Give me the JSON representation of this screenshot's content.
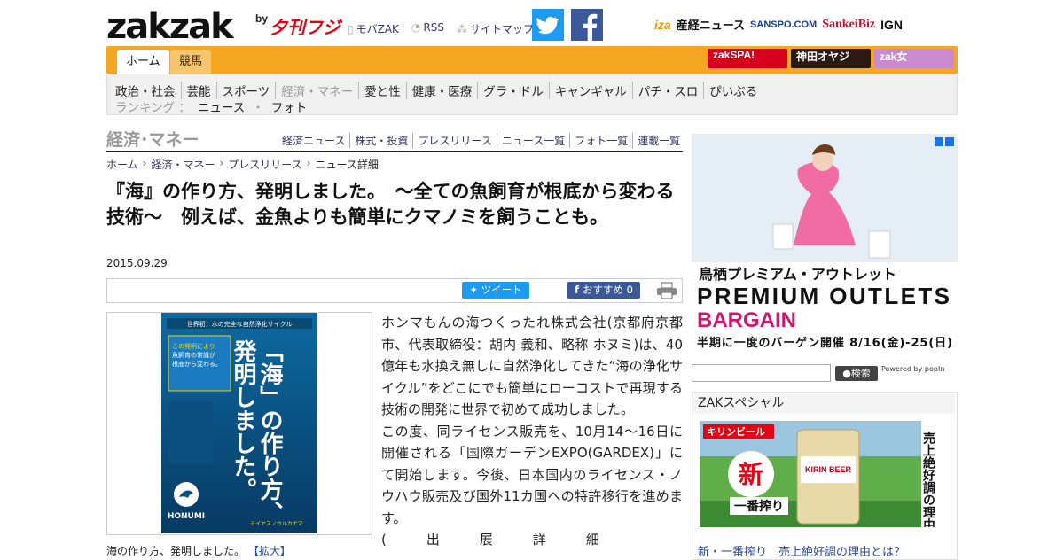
{
  "header": {
    "logo": "zakzak",
    "by": "by",
    "fuji_logo": "夕刊フジ",
    "links": [
      {
        "icon": "mobile-icon",
        "label": "モバZAK"
      },
      {
        "icon": "rss-icon",
        "label": "RSS"
      },
      {
        "icon": "sitemap-icon",
        "label": "サイトマップ"
      }
    ],
    "partners": [
      "iza",
      "産経ニュース",
      "SANSPO.COM",
      "SankeiBiz",
      "IGN"
    ]
  },
  "nav": {
    "tabs": [
      "ホーム",
      "競馬"
    ],
    "banners": [
      "zakSPA!",
      "神田オヤジ",
      "zak女"
    ]
  },
  "categories": [
    "政治・社会",
    "芸能",
    "スポーツ",
    "経済・マネー",
    "愛と性",
    "健康・医療",
    "グラ・ドル",
    "キャンギャル",
    "パチ・スロ",
    "ぴいぷる"
  ],
  "ranking": {
    "label": "ランキング ：",
    "items": [
      "ニュース",
      "・",
      "フォト"
    ]
  },
  "section": {
    "title": "経済･マネー",
    "links": [
      "経済ニュース",
      "株式・投資",
      "プレスリリース",
      "ニュース一覧",
      "フォト一覧",
      "連載一覧"
    ]
  },
  "breadcrumb": [
    "ホーム",
    "経済・マネー",
    "プレスリリース",
    "ニュース詳細"
  ],
  "article": {
    "headline": "『海』の作り方、発明しました。　～全ての魚飼育が根底から変わる技術～　例えば、金魚よりも簡単にクマノミを飼うことも。",
    "date": "2015.09.29",
    "tweet": "ツイート",
    "recommend": "おすすめ 0",
    "caption": "海の作り方、発明しました。",
    "caption_link": "【拡大】",
    "paragraphs": [
      "ホンマもんの海つくったれ株式会社(京都府京都市、代表取締役：胡内 義和、略称 ホヌミ)は、40億年も水換え無しに自然浄化してきた“海の浄化サイクル”をどこにでも簡単にローコストで再現する技術の開発に世界で初めて成功しました。",
      "この度、同ライセンス販売を、10月14～16日に開催される「国際ガーデンEXPO(GARDEX)」にて開始します。今後、日本国内のライセンス・ノウハウ販売及び国外11カ国への特許移行を進めます。",
      "(　　　出　　　展　　　詳　　　細"
    ]
  },
  "poster": {
    "top": "世界初：水の完全な自然浄化サイクル",
    "title1": "「海」の作り方、",
    "title2": "発明しました。",
    "side": "この発明により魚飼育の常識が根底から変わる。",
    "brand": "HONUMI",
    "foot": "ミイヤスノウルカナマ"
  },
  "sidebar": {
    "ad": {
      "line1": "鳥栖プレミアム・アウトレット",
      "line2": "PREMIUM OUTLETS",
      "line3": "BARGAIN",
      "line4": "半期に一度のバーゲン開催 8/16(金)-25(日)"
    },
    "search_button": "検索",
    "powered": "Powered by popIn",
    "zak_special": "ZAKスペシャル",
    "promo": {
      "brand": "キリンビール",
      "new": "新",
      "sub": "一番搾り",
      "beer": "KIRIN BEER",
      "right": "売上絶好調の理由とは"
    },
    "promo_caption": "新・一番搾り　売上絶好調の理由とは？"
  }
}
